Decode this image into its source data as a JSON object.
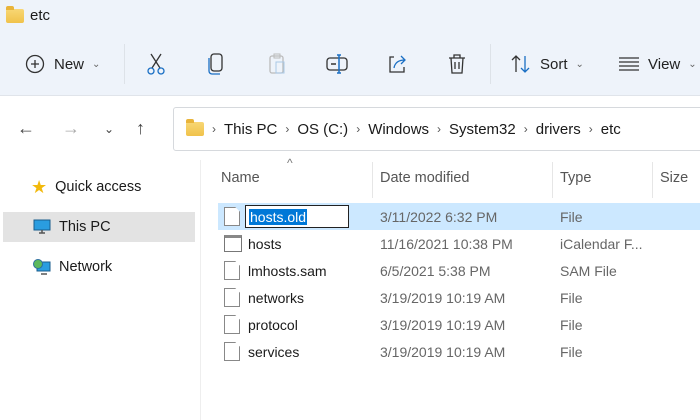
{
  "window": {
    "title": "etc"
  },
  "toolbar": {
    "new_label": "New",
    "sort_label": "Sort",
    "view_label": "View"
  },
  "breadcrumb": [
    "This PC",
    "OS (C:)",
    "Windows",
    "System32",
    "drivers",
    "etc"
  ],
  "sidebar": {
    "items": [
      {
        "label": "Quick access"
      },
      {
        "label": "This PC"
      },
      {
        "label": "Network"
      }
    ]
  },
  "columns": {
    "name": "Name",
    "date": "Date modified",
    "type": "Type",
    "size": "Size"
  },
  "files": [
    {
      "name": "hosts.old",
      "date": "3/11/2022 6:32 PM",
      "type": "File"
    },
    {
      "name": "hosts",
      "date": "11/16/2021 10:38 PM",
      "type": "iCalendar F..."
    },
    {
      "name": "lmhosts.sam",
      "date": "6/5/2021 5:38 PM",
      "type": "SAM File"
    },
    {
      "name": "networks",
      "date": "3/19/2019 10:19 AM",
      "type": "File"
    },
    {
      "name": "protocol",
      "date": "3/19/2019 10:19 AM",
      "type": "File"
    },
    {
      "name": "services",
      "date": "3/19/2019 10:19 AM",
      "type": "File"
    }
  ]
}
